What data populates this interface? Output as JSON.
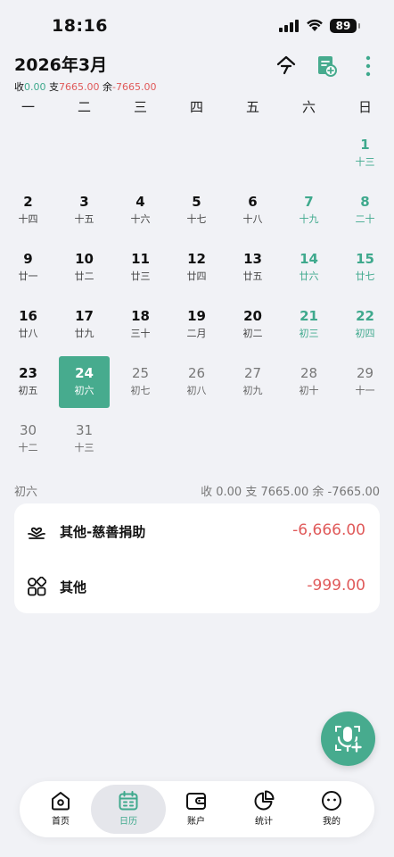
{
  "status": {
    "time": "18:16",
    "battery": "89"
  },
  "header": {
    "title": "2026年3月",
    "income_label": "收",
    "income": "0.00",
    "expense_label": "支",
    "expense": "7665.00",
    "balance_label": "余",
    "balance": "-7665.00",
    "icons": [
      "today-icon",
      "add-note-icon",
      "more-icon"
    ]
  },
  "weekdays": [
    "一",
    "二",
    "三",
    "四",
    "五",
    "六",
    "日"
  ],
  "days": [
    {
      "d": "1",
      "l": "十三"
    },
    {
      "d": "2",
      "l": "十四"
    },
    {
      "d": "3",
      "l": "十五"
    },
    {
      "d": "4",
      "l": "十六"
    },
    {
      "d": "5",
      "l": "十七"
    },
    {
      "d": "6",
      "l": "十八"
    },
    {
      "d": "7",
      "l": "十九"
    },
    {
      "d": "8",
      "l": "二十"
    },
    {
      "d": "9",
      "l": "廿一"
    },
    {
      "d": "10",
      "l": "廿二"
    },
    {
      "d": "11",
      "l": "廿三"
    },
    {
      "d": "12",
      "l": "廿四"
    },
    {
      "d": "13",
      "l": "廿五"
    },
    {
      "d": "14",
      "l": "廿六"
    },
    {
      "d": "15",
      "l": "廿七"
    },
    {
      "d": "16",
      "l": "廿八"
    },
    {
      "d": "17",
      "l": "廿九"
    },
    {
      "d": "18",
      "l": "三十"
    },
    {
      "d": "19",
      "l": "二月"
    },
    {
      "d": "20",
      "l": "初二"
    },
    {
      "d": "21",
      "l": "初三"
    },
    {
      "d": "22",
      "l": "初四"
    },
    {
      "d": "23",
      "l": "初五"
    },
    {
      "d": "24",
      "l": "初六"
    },
    {
      "d": "25",
      "l": "初七"
    },
    {
      "d": "26",
      "l": "初八"
    },
    {
      "d": "27",
      "l": "初九"
    },
    {
      "d": "28",
      "l": "初十"
    },
    {
      "d": "29",
      "l": "十一"
    },
    {
      "d": "30",
      "l": "十二"
    },
    {
      "d": "31",
      "l": "十三"
    }
  ],
  "first_weekday_index": 6,
  "selected_day": "24",
  "today_day": "24",
  "day_summary": {
    "lunar": "初六",
    "income_label": "收",
    "income": "0.00",
    "expense_label": "支",
    "expense": "7665.00",
    "balance_label": "余",
    "balance": "-7665.00"
  },
  "records": [
    {
      "name": "其他-慈善捐助",
      "amount": "-6,666.00",
      "icon": "charity-icon"
    },
    {
      "name": "其他",
      "amount": "-999.00",
      "icon": "category-grid-icon"
    }
  ],
  "fab": {
    "icon": "voice-add-icon"
  },
  "tabs": [
    {
      "label": "首页",
      "icon": "home-icon"
    },
    {
      "label": "日历",
      "icon": "calendar-icon",
      "active": true
    },
    {
      "label": "账户",
      "icon": "wallet-icon"
    },
    {
      "label": "统计",
      "icon": "pie-chart-icon"
    },
    {
      "label": "我的",
      "icon": "profile-face-icon"
    }
  ],
  "colors": {
    "accent": "#47ab8e",
    "expense": "#e05a5a",
    "background": "#f1f2f6"
  }
}
